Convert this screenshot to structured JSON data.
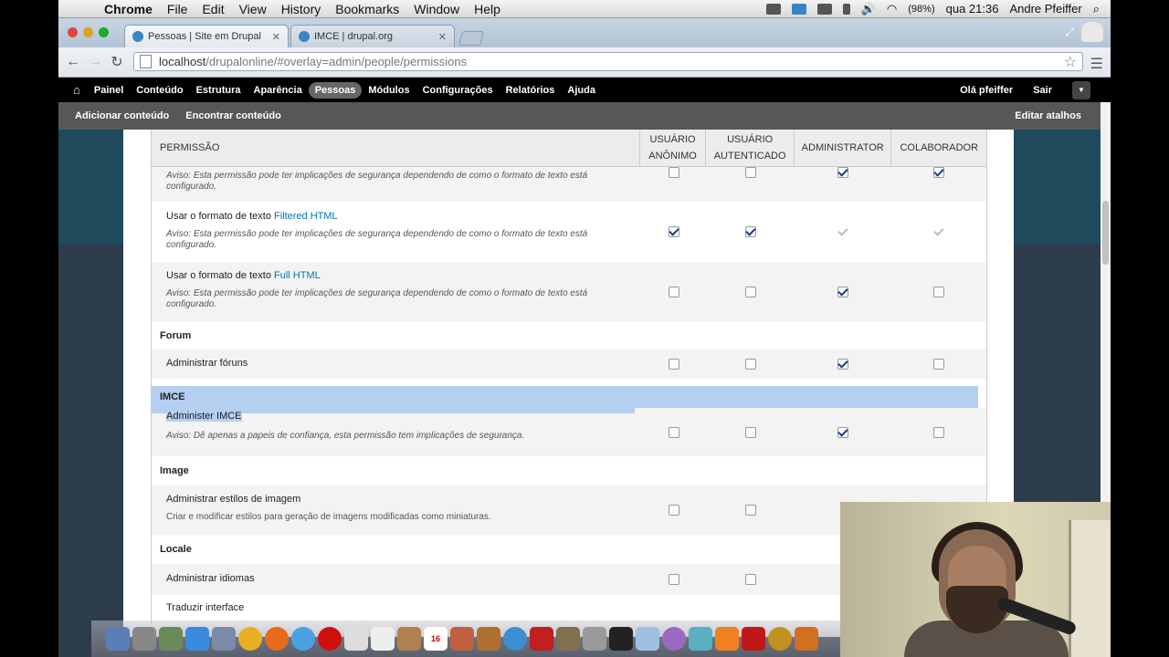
{
  "menubar": {
    "apple": "",
    "app": "Chrome",
    "items": [
      "File",
      "Edit",
      "View",
      "History",
      "Bookmarks",
      "Window",
      "Help"
    ],
    "battery": "(98%)",
    "clock": "qua 21:36",
    "user": "Andre Pfeiffer"
  },
  "tabs": [
    {
      "label": "Pessoas | Site em Drupal"
    },
    {
      "label": "IMCE | drupal.org"
    }
  ],
  "url": {
    "host": "localhost",
    "path": "/drupalonline/#overlay=admin/people/permissions"
  },
  "drupal_toolbar": {
    "items": [
      "Painel",
      "Conteúdo",
      "Estrutura",
      "Aparência",
      "Pessoas",
      "Módulos",
      "Configurações",
      "Relatórios",
      "Ajuda"
    ],
    "active": "Pessoas",
    "greeting": "Olá pfeiffer",
    "logout": "Sair"
  },
  "shortcuts": {
    "items": [
      "Adicionar conteúdo",
      "Encontrar conteúdo"
    ],
    "edit": "Editar atalhos"
  },
  "table": {
    "headers": {
      "permission": "PERMISSÃO",
      "anon_l1": "USUÁRIO",
      "anon_l2": "ANÔNIMO",
      "auth_l1": "USUÁRIO",
      "auth_l2": "AUTENTICADO",
      "admin": "ADMINISTRATOR",
      "colab": "COLABORADOR"
    },
    "warn_format": "Aviso: Esta permissão pode ter implicações de segurança dependendo de como o formato de texto está configurado.",
    "row_partial": {
      "anon": false,
      "auth": false,
      "admin": true,
      "colab": true
    },
    "row_filtered": {
      "prefix": "Usar o formato de texto ",
      "link": "Filtered HTML",
      "anon": true,
      "auth": true,
      "admin": "disabled",
      "colab": "disabled"
    },
    "row_full": {
      "prefix": "Usar o formato de texto ",
      "link": "Full HTML",
      "anon": false,
      "auth": false,
      "admin": true,
      "colab": false
    },
    "forum": {
      "module": "Forum",
      "perm": "Administrar fóruns",
      "anon": false,
      "auth": false,
      "admin": true,
      "colab": false
    },
    "imce": {
      "module": "IMCE",
      "perm": "Administer IMCE",
      "warn": "Aviso: Dê apenas a papeis de confiança, esta permissão tem implicações de segurança.",
      "anon": false,
      "auth": false,
      "admin": true,
      "colab": false
    },
    "image": {
      "module": "Image",
      "perm": "Administrar estilos de imagem",
      "desc": "Criar e modificar estilos para geração de imagens modificadas como miniaturas."
    },
    "locale": {
      "module": "Locale",
      "perm": "Administrar idiomas",
      "next": "Traduzir interface"
    }
  },
  "dock": {
    "calendar_day": "16"
  }
}
